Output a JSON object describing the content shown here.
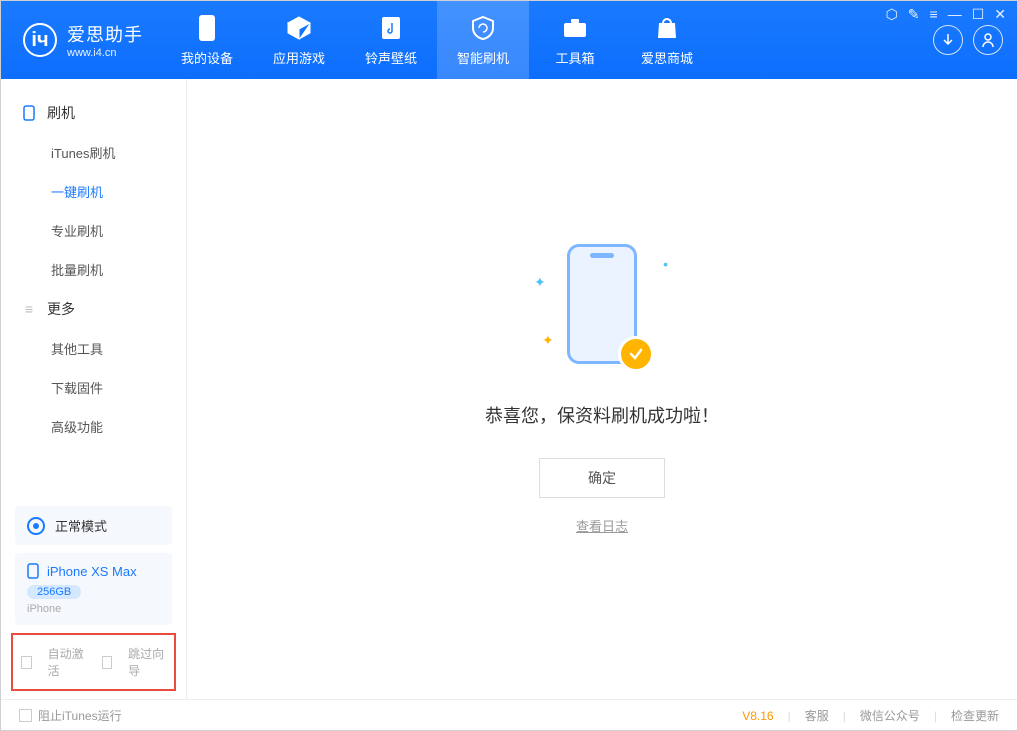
{
  "app": {
    "name": "爱思助手",
    "site": "www.i4.cn"
  },
  "nav": {
    "tabs": [
      {
        "label": "我的设备"
      },
      {
        "label": "应用游戏"
      },
      {
        "label": "铃声壁纸"
      },
      {
        "label": "智能刷机"
      },
      {
        "label": "工具箱"
      },
      {
        "label": "爱思商城"
      }
    ],
    "active_index": 3
  },
  "sidebar": {
    "groups": [
      {
        "title": "刷机",
        "items": [
          "iTunes刷机",
          "一键刷机",
          "专业刷机",
          "批量刷机"
        ],
        "active_index": 1
      },
      {
        "title": "更多",
        "items": [
          "其他工具",
          "下载固件",
          "高级功能"
        ],
        "active_index": -1
      }
    ],
    "mode_label": "正常模式",
    "device": {
      "name": "iPhone XS Max",
      "capacity": "256GB",
      "type": "iPhone"
    },
    "checkboxes": {
      "auto_activate": "自动激活",
      "skip_guide": "跳过向导"
    }
  },
  "main": {
    "success_message": "恭喜您，保资料刷机成功啦！",
    "ok_button": "确定",
    "view_log": "查看日志"
  },
  "footer": {
    "stop_itunes": "阻止iTunes运行",
    "version": "V8.16",
    "links": [
      "客服",
      "微信公众号",
      "检查更新"
    ]
  }
}
